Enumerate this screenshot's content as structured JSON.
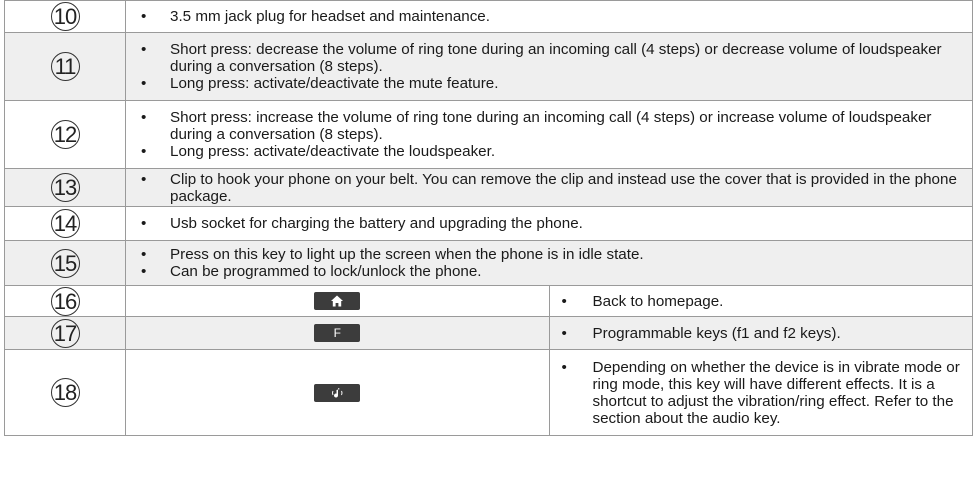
{
  "rows": [
    {
      "number": "10",
      "items": [
        "3.5 mm jack plug for headset and maintenance."
      ]
    },
    {
      "number": "11",
      "items": [
        "Short press: decrease the volume of ring tone during an incoming call (4 steps) or decrease volume of loudspeaker during a conversation (8 steps).",
        "Long press: activate/deactivate the mute feature."
      ]
    },
    {
      "number": "12",
      "items": [
        "Short press: increase the volume of ring tone during an incoming call (4 steps) or increase volume of loudspeaker during a conversation (8 steps).",
        "Long press: activate/deactivate the loudspeaker."
      ]
    },
    {
      "number": "13",
      "items": [
        "Clip to hook your phone on your belt. You can remove the clip and instead use the cover that is provided in the phone package."
      ]
    },
    {
      "number": "14",
      "items": [
        "Usb socket for charging the battery and upgrading the phone."
      ]
    },
    {
      "number": "15",
      "items": [
        "Press on this key to light up the screen when the phone is in idle state.",
        "Can be programmed to lock/unlock the phone."
      ]
    },
    {
      "number": "16",
      "key_icon": "home-icon",
      "items": [
        "Back to homepage."
      ]
    },
    {
      "number": "17",
      "key_icon": "f-key-icon",
      "key_label": "F",
      "items": [
        "Programmable keys (f1 and f2 keys)."
      ]
    },
    {
      "number": "18",
      "key_icon": "audio-key-icon",
      "items": [
        "Depending on whether the device is in vibrate mode or ring mode, this key will have different effects. It is a shortcut to adjust the vibration/ring effect. Refer to the section about the audio key."
      ]
    }
  ],
  "colors": {
    "key_background": "#3c3c3c",
    "shaded_row": "#efefef",
    "border": "#9a9a9a"
  }
}
